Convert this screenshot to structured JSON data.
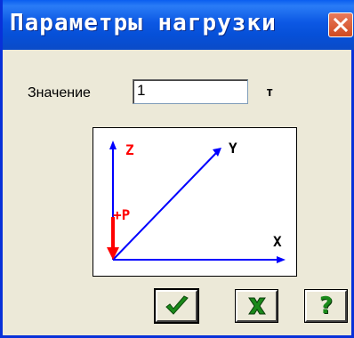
{
  "window": {
    "title": "Параметры нагрузки",
    "close_icon": "close-icon"
  },
  "form": {
    "value_label": "Значение",
    "value": "1",
    "unit": "т"
  },
  "diagram": {
    "z_label": "Z",
    "y_label": "Y",
    "x_label": "X",
    "force_label": "+P",
    "colors": {
      "axis": "#0000ff",
      "force": "#ff0000"
    }
  },
  "buttons": {
    "ok_icon": "checkmark-icon",
    "cancel_icon": "x-icon",
    "help_label": "?"
  }
}
